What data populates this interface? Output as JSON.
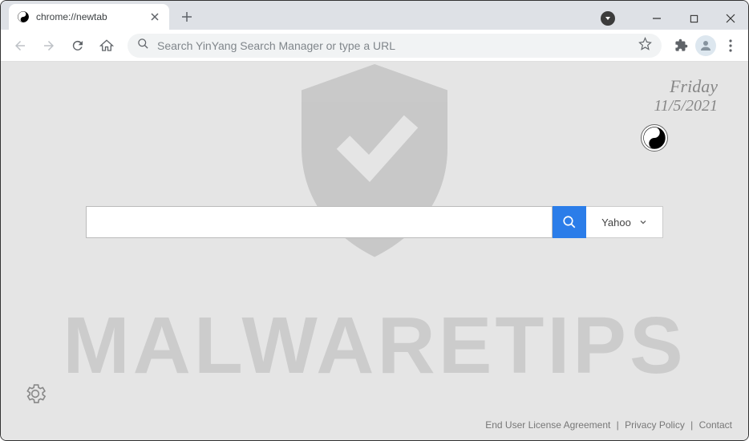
{
  "tab": {
    "title": "chrome://newtab"
  },
  "omnibox": {
    "placeholder": "Search YinYang Search Manager or type a URL"
  },
  "date": {
    "day": "Friday",
    "date": "11/5/2021"
  },
  "search": {
    "provider": "Yahoo"
  },
  "footer": {
    "eula": "End User License Agreement",
    "privacy": "Privacy Policy",
    "contact": "Contact",
    "sep": "|"
  },
  "watermark": "MALWARETIPS"
}
